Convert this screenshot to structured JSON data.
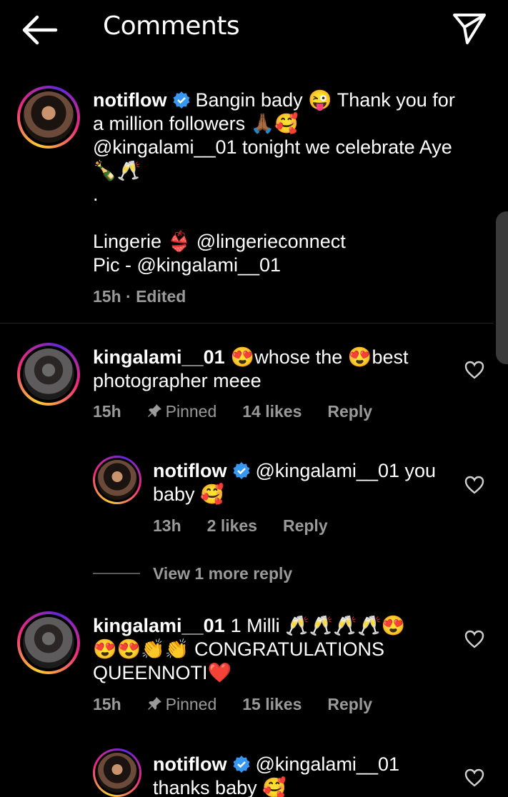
{
  "header": {
    "title": "Comments",
    "back_icon": "arrow-left-icon",
    "send_icon": "send-icon"
  },
  "caption": {
    "username": "notiflow",
    "line1": "Bangin bady 😜 Thank you for",
    "line2": "a million followers 🙏🏾🥰",
    "line3": "@kingalami__01 tonight we celebrate Aye",
    "line4": "🍾🥂",
    "line5": ".",
    "line6": "Lingerie 👙 @lingerieconnect",
    "line7": "Pic - @kingalami__01",
    "meta": "15h · Edited"
  },
  "comments": [
    {
      "username": "kingalami__01",
      "line1": "😍whose the 😍best",
      "line2": "photographer meee",
      "time": "15h",
      "pinned": "Pinned",
      "likes": "14 likes",
      "reply": "Reply"
    },
    {
      "username": "notiflow",
      "line1": "@kingalami__01 you",
      "line2": "baby 🥰",
      "time": "13h",
      "likes": "2 likes",
      "reply": "Reply"
    },
    {
      "username": "kingalami__01",
      "line1": "1 Milli 🥂🥂🥂🥂😍",
      "line2": "😍😍👏👏 CONGRATULATIONS",
      "line3": "QUEENNOTI❤️",
      "time": "15h",
      "pinned": "Pinned",
      "likes": "15 likes",
      "reply": "Reply"
    },
    {
      "username": "notiflow",
      "line1": "@kingalami__01",
      "line2": "thanks baby 🥰"
    }
  ],
  "view_more": "View 1 more reply",
  "colors": {
    "background": "#000000",
    "meta": "#9a9a9a",
    "verified": "#3897f0",
    "divider": "#262626"
  }
}
